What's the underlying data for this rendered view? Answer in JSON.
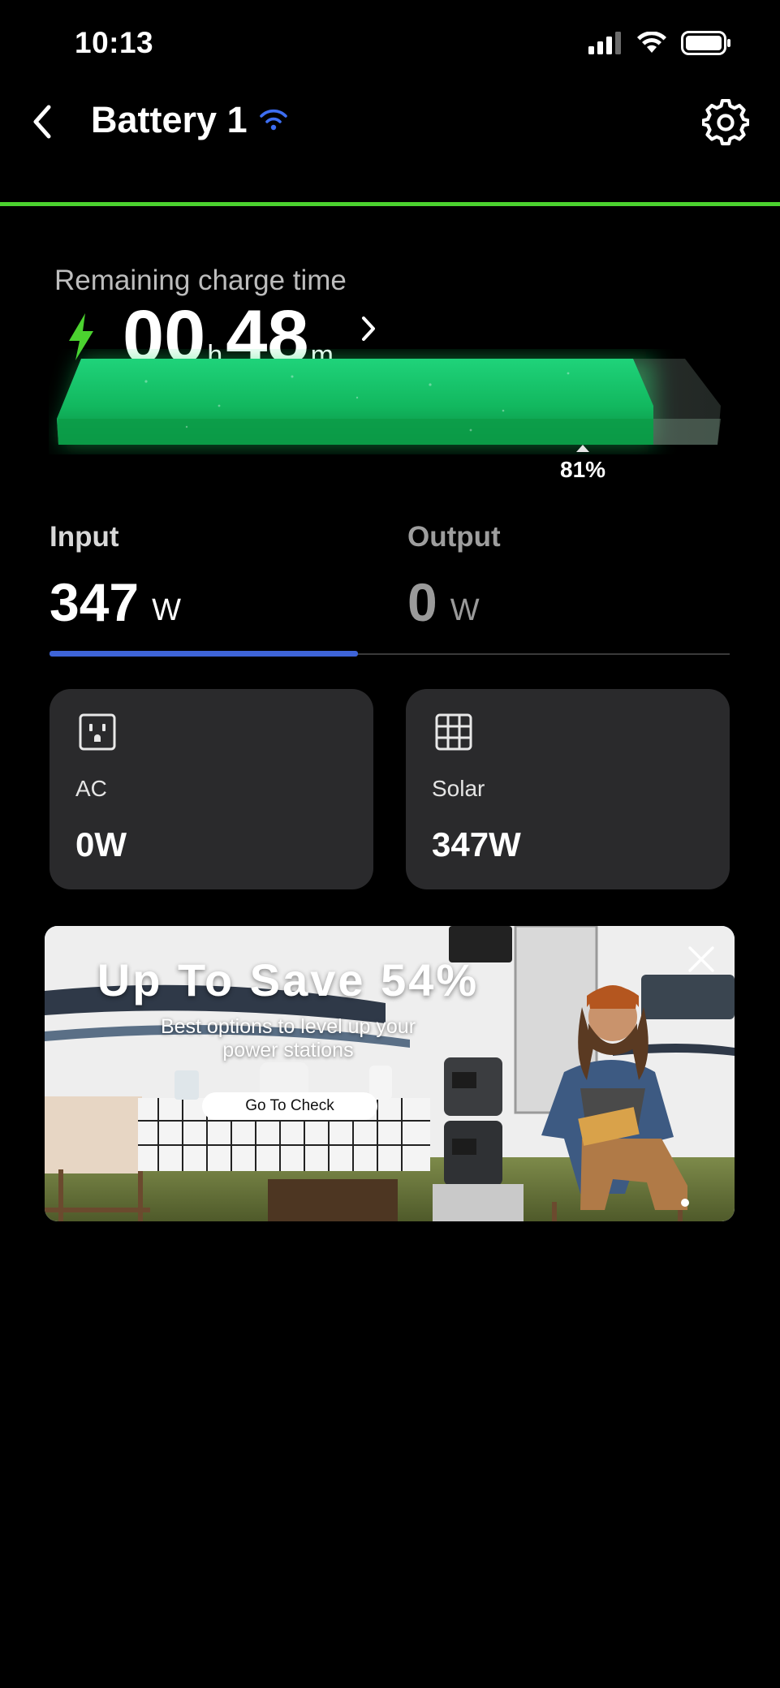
{
  "status": {
    "time": "10:13"
  },
  "header": {
    "title": "Battery 1"
  },
  "charge": {
    "label": "Remaining charge time",
    "hours": "00",
    "hours_unit": "h",
    "minutes": "48",
    "minutes_unit": "m",
    "percent": 81,
    "percent_label": "81%"
  },
  "io": {
    "input_label": "Input",
    "input_value": "347",
    "input_unit": "W",
    "output_label": "Output",
    "output_value": "0",
    "output_unit": "W"
  },
  "sources": [
    {
      "label": "AC",
      "value": "0W",
      "icon": "ac-outlet-icon"
    },
    {
      "label": "Solar",
      "value": "347W",
      "icon": "solar-panel-icon"
    }
  ],
  "banner": {
    "title": "Up To Save 54%",
    "subtitle": "Best options to level up your power stations",
    "button": "Go To Check"
  },
  "colors": {
    "accent_green": "#4bd22f",
    "input_blue": "#3e64d8",
    "card_bg": "#2a2a2c"
  }
}
